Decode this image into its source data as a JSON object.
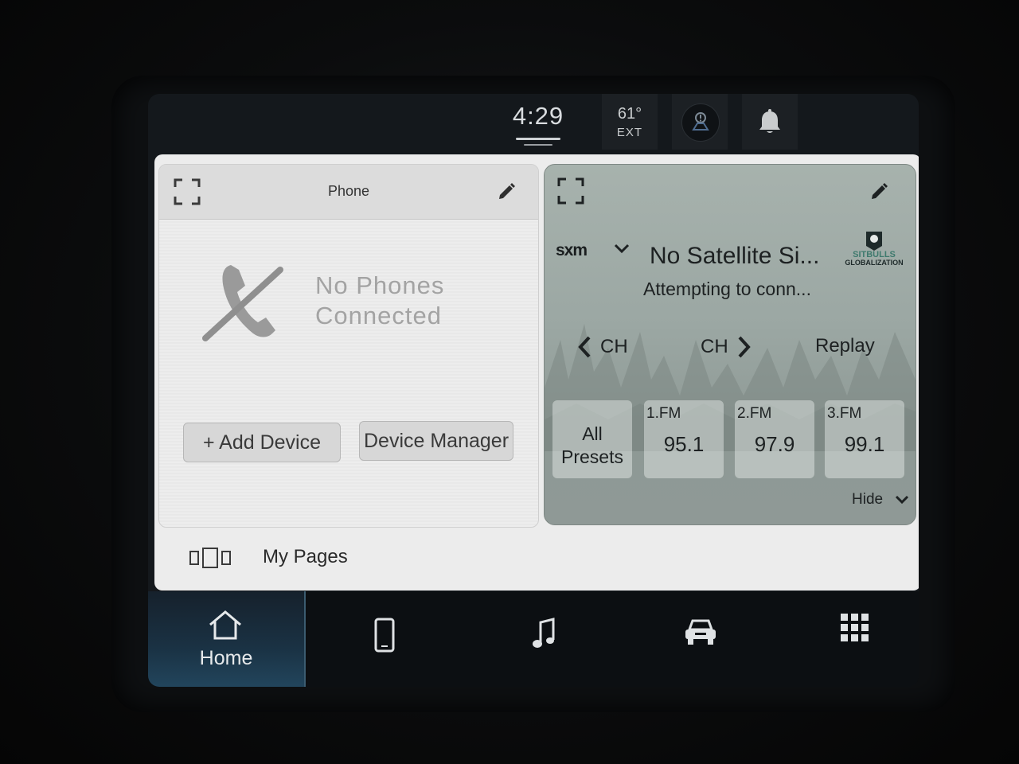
{
  "status_bar": {
    "time": "4:29",
    "temperature": "61°",
    "temperature_label": "EXT",
    "icons": [
      "alert-circle-icon",
      "bell-icon"
    ]
  },
  "phone_widget": {
    "title": "Phone",
    "message_line1": "No Phones",
    "message_line2": "Connected",
    "add_device_label": "+ Add Device",
    "device_manager_label": "Device Manager",
    "icons": [
      "expand-icon",
      "edit-pencil-icon",
      "phone-disconnected-icon"
    ]
  },
  "radio_widget": {
    "source": "sxm",
    "station": "No Satellite Si...",
    "status": "Attempting to conn...",
    "channel_down_label": "CH",
    "channel_up_label": "CH",
    "replay_label": "Replay",
    "logo_text_line1": "SITBULLS",
    "logo_text_line2": "GLOBALIZATION",
    "all_presets_line1": "All",
    "all_presets_line2": "Presets",
    "presets": [
      {
        "label": "1.FM",
        "value": "95.1"
      },
      {
        "label": "2.FM",
        "value": "97.9"
      },
      {
        "label": "3.FM",
        "value": "99.1"
      }
    ],
    "hide_label": "Hide"
  },
  "my_pages": {
    "label": "My Pages"
  },
  "bottom_nav": {
    "home_label": "Home",
    "items": [
      "home-icon",
      "phone-icon",
      "music-note-icon",
      "vehicle-icon",
      "apps-grid-icon"
    ]
  },
  "colors": {
    "screen_bg": "#14181c",
    "panel_bg": "#ececec",
    "radio_bg": "#9ba7a3",
    "home_active": "#22455c"
  }
}
